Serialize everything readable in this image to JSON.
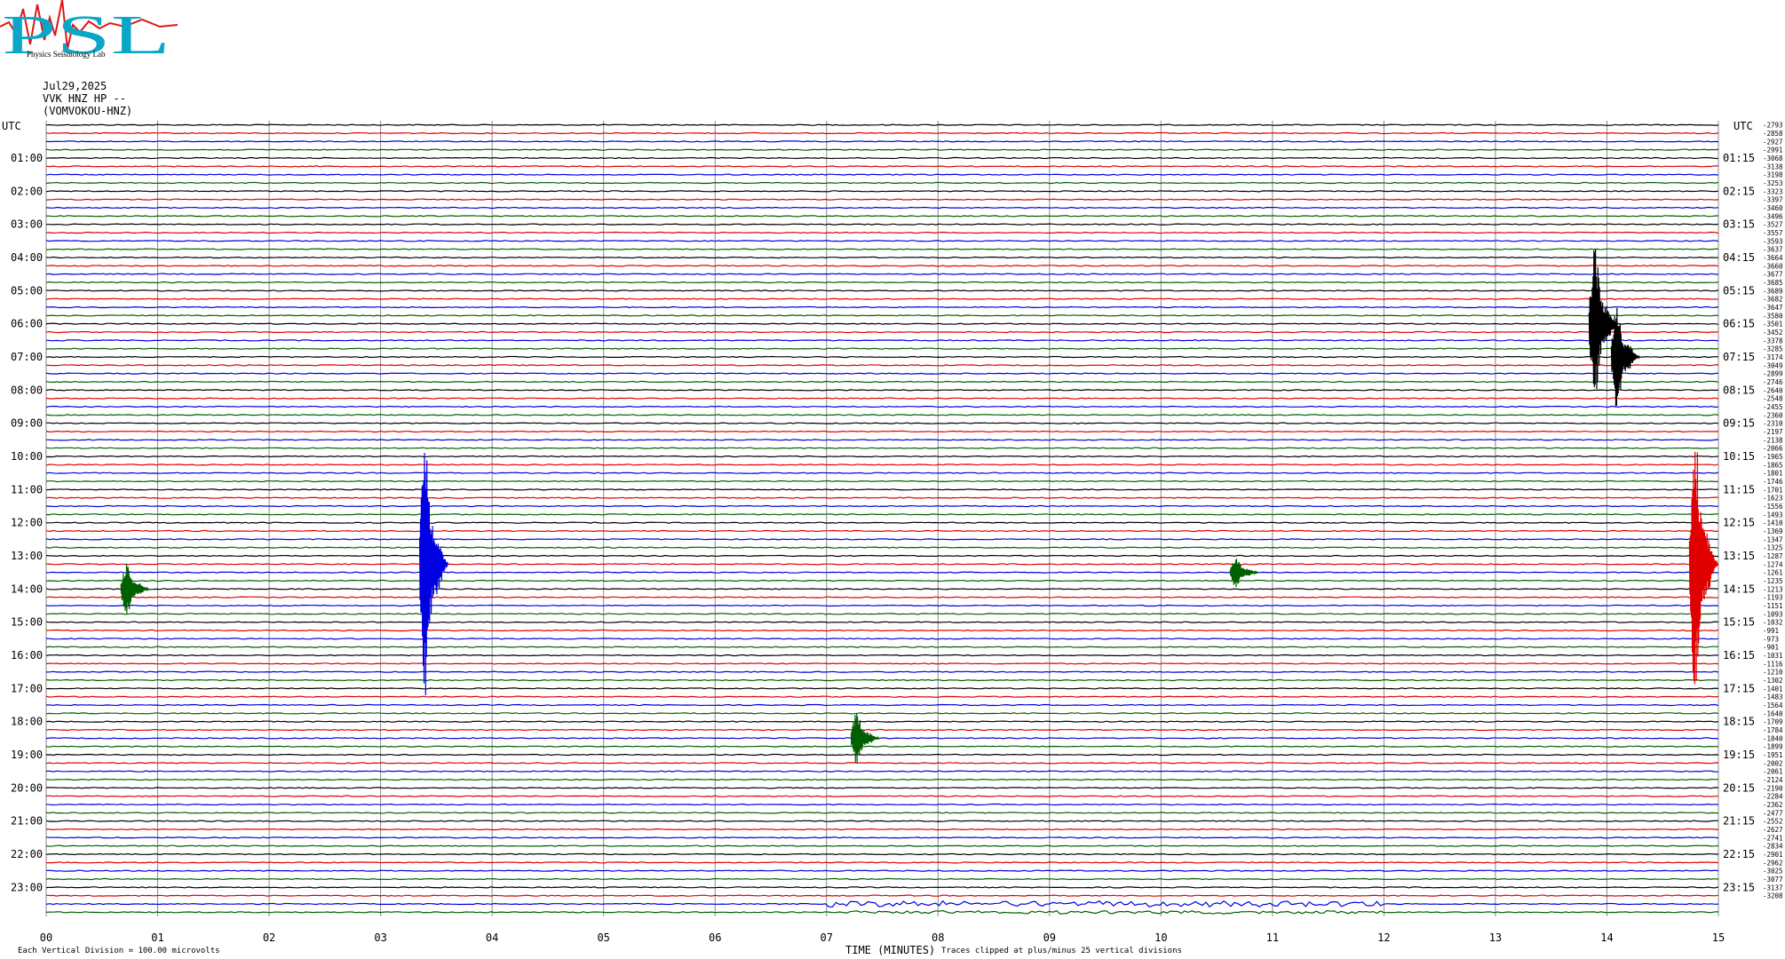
{
  "logo": {
    "text": "PSL",
    "small_text": "Physics Seismology Lab"
  },
  "header": {
    "date": "Jul29,2025",
    "station": "VVK HNZ HP --",
    "channel": "(VOMVOKOU-HNZ)"
  },
  "chart_data": {
    "type": "line",
    "title": "",
    "xlabel": "TIME (MINUTES)",
    "x_ticks": [
      "00",
      "01",
      "02",
      "03",
      "04",
      "05",
      "06",
      "07",
      "08",
      "09",
      "10",
      "11",
      "12",
      "13",
      "14",
      "15"
    ],
    "xlim": [
      0,
      15
    ],
    "left_axis_label": "UTC",
    "right_axis_label": "UTC",
    "left_hours": [
      "01:00",
      "02:00",
      "03:00",
      "04:00",
      "05:00",
      "06:00",
      "07:00",
      "08:00",
      "09:00",
      "10:00",
      "11:00",
      "12:00",
      "13:00",
      "14:00",
      "15:00",
      "16:00",
      "17:00",
      "18:00",
      "19:00",
      "20:00",
      "21:00",
      "22:00",
      "23:00"
    ],
    "right_hours": [
      "01:15",
      "02:15",
      "03:15",
      "04:15",
      "05:15",
      "06:15",
      "07:15",
      "08:15",
      "09:15",
      "10:15",
      "11:15",
      "12:15",
      "13:15",
      "14:15",
      "15:15",
      "16:15",
      "17:15",
      "18:15",
      "19:15",
      "20:15",
      "21:15",
      "22:15",
      "23:15"
    ],
    "trace_count": 96,
    "trace_colors": [
      "#000000",
      "#e00000",
      "#0000e0",
      "#006000"
    ],
    "trace_offsets": [
      2793,
      2858,
      2927,
      2991,
      3068,
      3138,
      3198,
      3253,
      3323,
      3397,
      3460,
      3496,
      3527,
      3557,
      3593,
      3637,
      3664,
      3660,
      3677,
      3685,
      3689,
      3682,
      3647,
      3580,
      3501,
      3452,
      3378,
      3285,
      3174,
      3049,
      2899,
      2746,
      2640,
      2548,
      2455,
      2360,
      2310,
      2197,
      2138,
      2066,
      1965,
      1865,
      1801,
      1746,
      1701,
      1623,
      1556,
      1493,
      1410,
      1369,
      1347,
      1325,
      1287,
      1274,
      1261,
      1235,
      1213,
      1193,
      1151,
      1093,
      1032,
      991,
      973,
      901,
      1031,
      1116,
      1210,
      1302,
      1401,
      1483,
      1564,
      1640,
      1709,
      1784,
      1840,
      1899,
      1951,
      2002,
      2061,
      2124,
      2190,
      2284,
      2362,
      2477,
      2552,
      2627,
      2741,
      2834,
      2901,
      2962,
      3025,
      3077,
      3137,
      3208
    ],
    "events": [
      {
        "trace": 24,
        "minute": 13.92,
        "amplitude": 3.0,
        "color": "#000000"
      },
      {
        "trace": 28,
        "minute": 14.12,
        "amplitude": 2.0,
        "color": "#000000"
      },
      {
        "trace": 53,
        "minute": 3.43,
        "amplitude": 5.0,
        "color": "#0000e0"
      },
      {
        "trace": 53,
        "minute": 14.82,
        "amplitude": 5.0,
        "color": "#e00000"
      },
      {
        "trace": 56,
        "minute": 0.75,
        "amplitude": 1.0,
        "color": "#006000"
      },
      {
        "trace": 74,
        "minute": 7.3,
        "amplitude": 1.0,
        "color": "#006000"
      },
      {
        "trace": 54,
        "minute": 10.7,
        "amplitude": 0.6,
        "color": "#006000"
      }
    ],
    "annotations": {
      "vertical_division": "Each Vertical Division =  100.00 microvolts",
      "clip_note": "Traces clipped at plus/minus 25 vertical divisions"
    },
    "grid": true
  }
}
